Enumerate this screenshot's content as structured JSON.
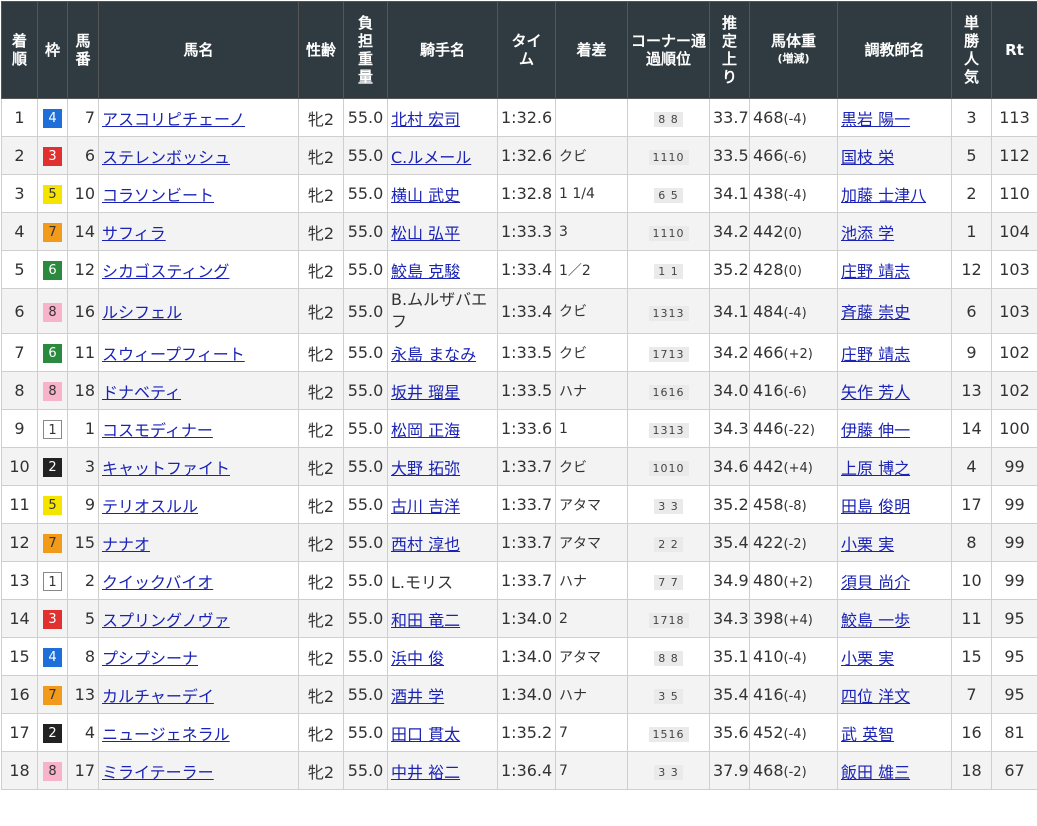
{
  "headers": {
    "rank": "着順",
    "waku": "枠",
    "umaban": "馬番",
    "name": "馬名",
    "sexage": "性齢",
    "weight": "負担重量",
    "jockey": "騎手名",
    "time": "タイム",
    "margin": "着差",
    "corner": "コーナー通過順位",
    "last3f": "推定上り",
    "bodyweight": "馬体重",
    "bodyweight_sub": "(増減)",
    "trainer": "調教師名",
    "popularity": "単勝人気",
    "rt": "Rt"
  },
  "rows": [
    {
      "rank": "1",
      "waku": "4",
      "umaban": "7",
      "name": "アスコリピチェーノ",
      "sexage": "牝2",
      "weight": "55.0",
      "jockey": "北村 宏司",
      "time": "1:32.6",
      "margin": "",
      "corner": "8 8",
      "last3f": "33.7",
      "bw": "468",
      "bwd": "(-4)",
      "trainer": "黒岩 陽一",
      "pop": "3",
      "rt": "113"
    },
    {
      "rank": "2",
      "waku": "3",
      "umaban": "6",
      "name": "ステレンボッシュ",
      "sexage": "牝2",
      "weight": "55.0",
      "jockey": "C.ルメール",
      "time": "1:32.6",
      "margin": "クビ",
      "corner": "1110",
      "last3f": "33.5",
      "bw": "466",
      "bwd": "(-6)",
      "trainer": "国枝 栄",
      "pop": "5",
      "rt": "112"
    },
    {
      "rank": "3",
      "waku": "5",
      "umaban": "10",
      "name": "コラソンビート",
      "sexage": "牝2",
      "weight": "55.0",
      "jockey": "横山 武史",
      "time": "1:32.8",
      "margin": "1 1/4",
      "corner": "6 5",
      "last3f": "34.1",
      "bw": "438",
      "bwd": "(-4)",
      "trainer": "加藤 士津八",
      "pop": "2",
      "rt": "110"
    },
    {
      "rank": "4",
      "waku": "7",
      "umaban": "14",
      "name": "サフィラ",
      "sexage": "牝2",
      "weight": "55.0",
      "jockey": "松山 弘平",
      "time": "1:33.3",
      "margin": "3",
      "corner": "1110",
      "last3f": "34.2",
      "bw": "442",
      "bwd": "(0)",
      "trainer": "池添 学",
      "pop": "1",
      "rt": "104"
    },
    {
      "rank": "5",
      "waku": "6",
      "umaban": "12",
      "name": "シカゴスティング",
      "sexage": "牝2",
      "weight": "55.0",
      "jockey": "鮫島 克駿",
      "time": "1:33.4",
      "margin": "1／2",
      "corner": "1 1",
      "last3f": "35.2",
      "bw": "428",
      "bwd": "(0)",
      "trainer": "庄野 靖志",
      "pop": "12",
      "rt": "103"
    },
    {
      "rank": "6",
      "waku": "8",
      "umaban": "16",
      "name": "ルシフェル",
      "sexage": "牝2",
      "weight": "55.0",
      "jockey": "B.ムルザバエフ",
      "time": "1:33.4",
      "margin": "クビ",
      "corner": "1313",
      "last3f": "34.1",
      "bw": "484",
      "bwd": "(-4)",
      "trainer": "斉藤 崇史",
      "pop": "6",
      "rt": "103"
    },
    {
      "rank": "7",
      "waku": "6",
      "umaban": "11",
      "name": "スウィープフィート",
      "sexage": "牝2",
      "weight": "55.0",
      "jockey": "永島 まなみ",
      "time": "1:33.5",
      "margin": "クビ",
      "corner": "1713",
      "last3f": "34.2",
      "bw": "466",
      "bwd": "(+2)",
      "trainer": "庄野 靖志",
      "pop": "9",
      "rt": "102"
    },
    {
      "rank": "8",
      "waku": "8",
      "umaban": "18",
      "name": "ドナベティ",
      "sexage": "牝2",
      "weight": "55.0",
      "jockey": "坂井 瑠星",
      "time": "1:33.5",
      "margin": "ハナ",
      "corner": "1616",
      "last3f": "34.0",
      "bw": "416",
      "bwd": "(-6)",
      "trainer": "矢作 芳人",
      "pop": "13",
      "rt": "102"
    },
    {
      "rank": "9",
      "waku": "1",
      "umaban": "1",
      "name": "コスモディナー",
      "sexage": "牝2",
      "weight": "55.0",
      "jockey": "松岡 正海",
      "time": "1:33.6",
      "margin": "1",
      "corner": "1313",
      "last3f": "34.3",
      "bw": "446",
      "bwd": "(-22)",
      "trainer": "伊藤 伸一",
      "pop": "14",
      "rt": "100"
    },
    {
      "rank": "10",
      "waku": "2",
      "umaban": "3",
      "name": "キャットファイト",
      "sexage": "牝2",
      "weight": "55.0",
      "jockey": "大野 拓弥",
      "time": "1:33.7",
      "margin": "クビ",
      "corner": "1010",
      "last3f": "34.6",
      "bw": "442",
      "bwd": "(+4)",
      "trainer": "上原 博之",
      "pop": "4",
      "rt": "99"
    },
    {
      "rank": "11",
      "waku": "5",
      "umaban": "9",
      "name": "テリオスルル",
      "sexage": "牝2",
      "weight": "55.0",
      "jockey": "古川 吉洋",
      "time": "1:33.7",
      "margin": "アタマ",
      "corner": "3 3",
      "last3f": "35.2",
      "bw": "458",
      "bwd": "(-8)",
      "trainer": "田島 俊明",
      "pop": "17",
      "rt": "99"
    },
    {
      "rank": "12",
      "waku": "7",
      "umaban": "15",
      "name": "ナナオ",
      "sexage": "牝2",
      "weight": "55.0",
      "jockey": "西村 淳也",
      "time": "1:33.7",
      "margin": "アタマ",
      "corner": "2 2",
      "last3f": "35.4",
      "bw": "422",
      "bwd": "(-2)",
      "trainer": "小栗 実",
      "pop": "8",
      "rt": "99"
    },
    {
      "rank": "13",
      "waku": "1",
      "umaban": "2",
      "name": "クイックバイオ",
      "sexage": "牝2",
      "weight": "55.0",
      "jockey": "L.モリス",
      "time": "1:33.7",
      "margin": "ハナ",
      "corner": "7 7",
      "last3f": "34.9",
      "bw": "480",
      "bwd": "(+2)",
      "trainer": "須貝 尚介",
      "pop": "10",
      "rt": "99"
    },
    {
      "rank": "14",
      "waku": "3",
      "umaban": "5",
      "name": "スプリングノヴァ",
      "sexage": "牝2",
      "weight": "55.0",
      "jockey": "和田 竜二",
      "time": "1:34.0",
      "margin": "2",
      "corner": "1718",
      "last3f": "34.3",
      "bw": "398",
      "bwd": "(+4)",
      "trainer": "鮫島 一歩",
      "pop": "11",
      "rt": "95"
    },
    {
      "rank": "15",
      "waku": "4",
      "umaban": "8",
      "name": "プシプシーナ",
      "sexage": "牝2",
      "weight": "55.0",
      "jockey": "浜中 俊",
      "time": "1:34.0",
      "margin": "アタマ",
      "corner": "8 8",
      "last3f": "35.1",
      "bw": "410",
      "bwd": "(-4)",
      "trainer": "小栗 実",
      "pop": "15",
      "rt": "95"
    },
    {
      "rank": "16",
      "waku": "7",
      "umaban": "13",
      "name": "カルチャーデイ",
      "sexage": "牝2",
      "weight": "55.0",
      "jockey": "酒井 学",
      "time": "1:34.0",
      "margin": "ハナ",
      "corner": "3 5",
      "last3f": "35.4",
      "bw": "416",
      "bwd": "(-4)",
      "trainer": "四位 洋文",
      "pop": "7",
      "rt": "95"
    },
    {
      "rank": "17",
      "waku": "2",
      "umaban": "4",
      "name": "ニュージェネラル",
      "sexage": "牝2",
      "weight": "55.0",
      "jockey": "田口 貫太",
      "time": "1:35.2",
      "margin": "7",
      "corner": "1516",
      "last3f": "35.6",
      "bw": "452",
      "bwd": "(-4)",
      "trainer": "武 英智",
      "pop": "16",
      "rt": "81"
    },
    {
      "rank": "18",
      "waku": "8",
      "umaban": "17",
      "name": "ミライテーラー",
      "sexage": "牝2",
      "weight": "55.0",
      "jockey": "中井 裕二",
      "time": "1:36.4",
      "margin": "7",
      "corner": "3 3",
      "last3f": "37.9",
      "bw": "468",
      "bwd": "(-2)",
      "trainer": "飯田 雄三",
      "pop": "18",
      "rt": "67"
    }
  ]
}
